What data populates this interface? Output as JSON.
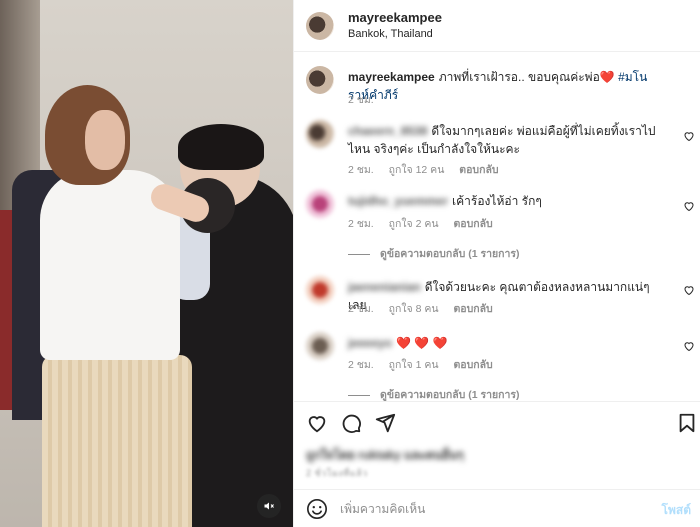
{
  "post": {
    "username": "mayreekampee",
    "location": "Bankok, Thailand"
  },
  "caption": {
    "username": "mayreekampee",
    "text": "ภาพที่เราเฝ้ารอ.. ขอบคุณค่ะพ่อ",
    "heart_emoji": "❤️",
    "hashtag": "#มโนราห์คำภีร์",
    "time": "2 ชม."
  },
  "comments": [
    {
      "username": "chaeern_8538",
      "text": "ดีใจมากๆเลยค่ะ พ่อแม่คือผู้ที่ไม่เคยทิ้งเราไปไหน จริงๆค่ะ เป็นกำลังใจให้นะคะ",
      "time": "2 ชม.",
      "likes": "ถูกใจ 12 คน",
      "reply": "ตอบกลับ"
    },
    {
      "username": "tujidho_yuemmer",
      "text": "เค้าร้องไห้อ่า รักๆ",
      "time": "2 ชม.",
      "likes": "ถูกใจ 2 คน",
      "reply": "ตอบกลับ",
      "view_replies": "ดูข้อความตอบกลับ (1 รายการ)"
    },
    {
      "username": "jaenenianian",
      "text": "ดีใจด้วยนะคะ คุณตาต้องหลงหลานมากแน่ๆเลย",
      "time": "2 ชม.",
      "likes": "ถูกใจ 8 คน",
      "reply": "ตอบกลับ"
    },
    {
      "username": "jeeeeyo",
      "text": "❤️ ❤️ ❤️",
      "time": "2 ชม.",
      "likes": "ถูกใจ 1 คน",
      "reply": "ตอบกลับ",
      "view_replies": "ดูข้อความตอบกลับ (1 รายการ)"
    }
  ],
  "likes_line": "ถูกใจโดย ruktaky และคนอื่นๆ",
  "time_ago_line": "2 ชั่วโมงที่แล้ว",
  "add_comment": {
    "placeholder": "เพิ่มความคิดเห็น",
    "post_label": "โพสต์"
  },
  "colors": {
    "link": "#00376b",
    "muted": "#8e8e8e",
    "post_disabled": "#b2dffc",
    "heart": "#ed4956"
  },
  "icons": [
    "heart-icon",
    "comment-icon",
    "share-icon",
    "bookmark-icon",
    "emoji-icon",
    "mute-icon"
  ]
}
